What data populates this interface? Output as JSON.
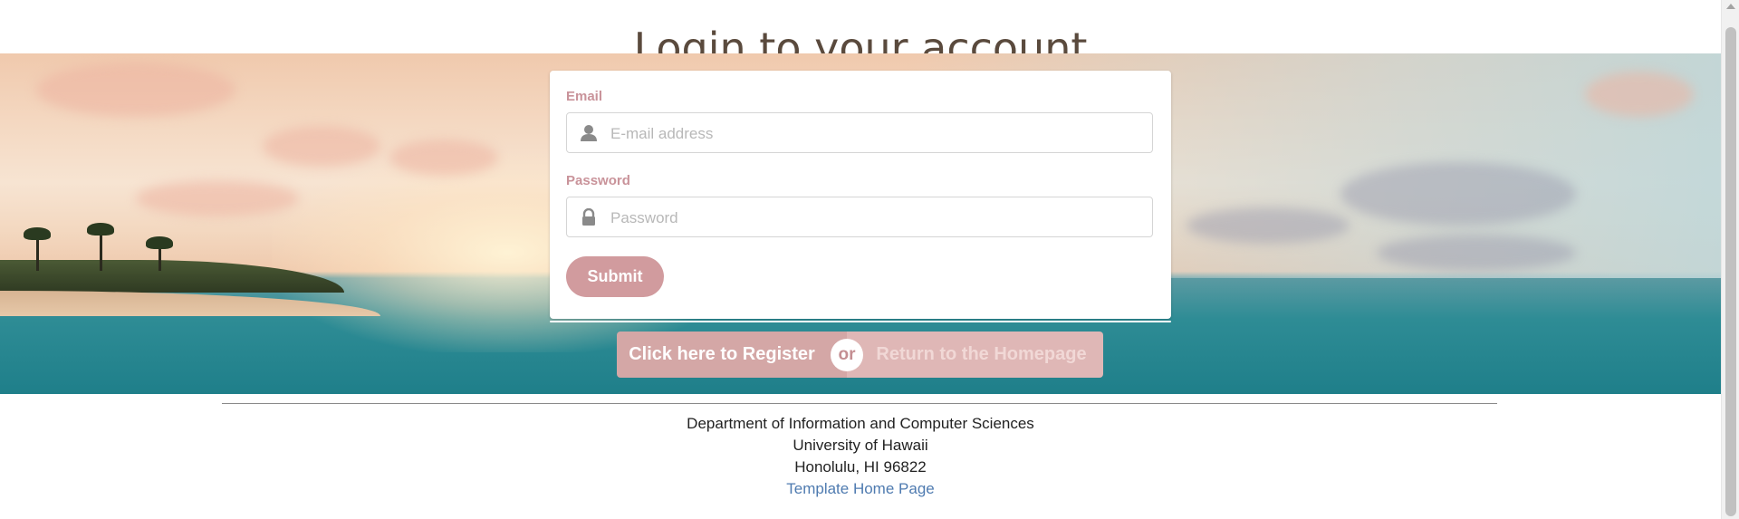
{
  "page": {
    "title": "Login to your account"
  },
  "login_form": {
    "email": {
      "label": "Email",
      "placeholder": "E-mail address",
      "value": "",
      "icon": "user-icon"
    },
    "password": {
      "label": "Password",
      "placeholder": "Password",
      "value": "",
      "icon": "lock-icon"
    },
    "submit_label": "Submit"
  },
  "actions": {
    "register_label": "Click here to Register",
    "or_label": "or",
    "homepage_label": "Return to the Homepage"
  },
  "footer": {
    "line1": "Department of Information and Computer Sciences",
    "line2": "University of Hawaii",
    "line3": "Honolulu, HI 96822",
    "link_label": "Template Home Page"
  },
  "colors": {
    "accent": "#d19b9e",
    "label": "#c9939a",
    "title": "#5a4a3d",
    "link": "#4f7bb0"
  }
}
